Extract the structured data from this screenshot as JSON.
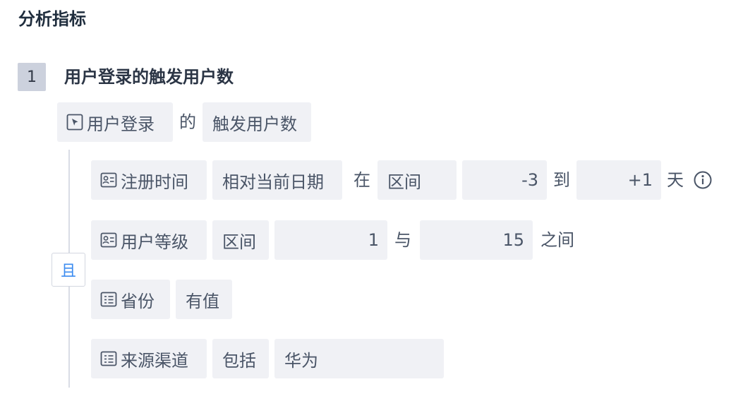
{
  "section_title": "分析指标",
  "metric": {
    "index": "1",
    "title": "用户登录的触发用户数",
    "event": "用户登录",
    "of": "的",
    "measure": "触发用户数"
  },
  "logic_toggle": "且",
  "filters": [
    {
      "icon": "user-card-icon",
      "property": "注册时间",
      "mode": "相对当前日期",
      "word_in": "在",
      "operator": "区间",
      "from": "-3",
      "word_to": "到",
      "to": "+1",
      "unit": "天",
      "info_icon": "info-circle-icon"
    },
    {
      "icon": "user-card-icon",
      "property": "用户等级",
      "operator": "区间",
      "from": "1",
      "word_and": "与",
      "to": "15",
      "suffix": "之间"
    },
    {
      "icon": "list-card-icon",
      "property": "省份",
      "operator": "有值"
    },
    {
      "icon": "list-card-icon",
      "property": "来源渠道",
      "operator": "包括",
      "value": "华为"
    }
  ]
}
